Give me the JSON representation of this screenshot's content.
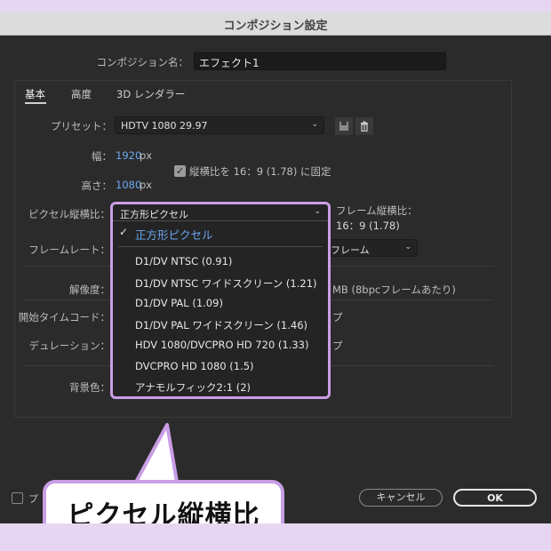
{
  "dialog": {
    "title": "コンポジション設定",
    "comp_name_label": "コンポジション名：",
    "comp_name_value": "エフェクト1",
    "tabs": [
      "基本",
      "高度",
      "3D レンダラー"
    ],
    "preset_label": "プリセット：",
    "preset_value": "HDTV 1080 29.97",
    "width_label": "幅：",
    "width_value": "1920",
    "width_unit": "px",
    "height_label": "高さ：",
    "height_value": "1080",
    "height_unit": "px",
    "lock_aspect_label": "縦横比を 16：9 (1.78) に固定",
    "pixel_aspect_label": "ピクセル縦横比：",
    "pixel_aspect_value": "正方形ピクセル",
    "frame_aspect_label": "フレーム縦横比：",
    "frame_aspect_value": "16：9 (1.78)",
    "frame_rate_label": "フレームレート：",
    "frame_rate_tail": "フレーム",
    "resolution_label": "解像度：",
    "resolution_tail": "MB (8bpcフレームあたり)",
    "start_tc_label": "開始タイムコード：",
    "start_tc_tail": "プ",
    "duration_label": "デュレーション：",
    "duration_tail": "プ",
    "bg_label": "背景色：",
    "preview_label": "プ",
    "cancel_label": "キャンセル",
    "ok_label": "OK",
    "colors": {
      "accent": "#6aa8f0",
      "highlight": "#c99ee6",
      "background": "#2b2b2b"
    }
  },
  "dropdown": {
    "selected": "正方形ピクセル",
    "options": [
      "D1/DV NTSC (0.91)",
      "D1/DV NTSC ワイドスクリーン (1.21)",
      "D1/DV PAL (1.09)",
      "D1/DV PAL ワイドスクリーン (1.46)",
      "HDV 1080/DVCPRO HD 720 (1.33)",
      "DVCPRO HD 1080 (1.5)",
      "アナモルフィック2:1 (2)"
    ]
  },
  "callout": {
    "text": "ピクセル縦横比"
  }
}
